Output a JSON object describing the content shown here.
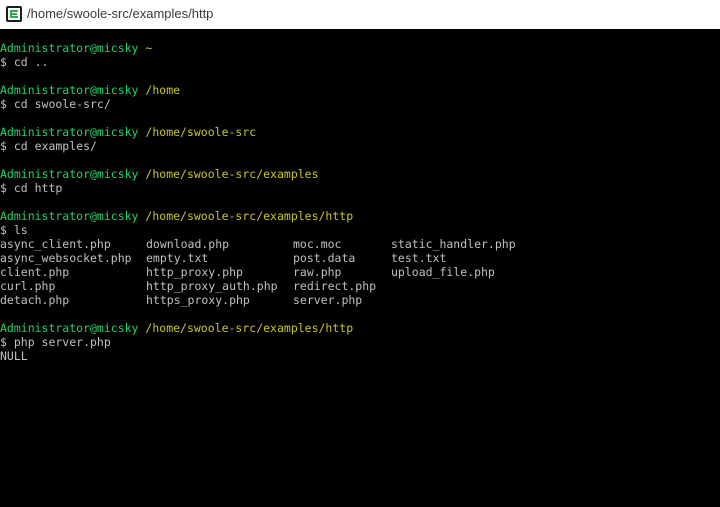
{
  "window": {
    "title": "/home/swoole-src/examples/http",
    "icon": "terminal-app-icon",
    "colors": {
      "background": "#000000",
      "text": "#c0c0c0",
      "user": "#23d16b",
      "path": "#c7c62c"
    }
  },
  "terminal": {
    "blocks": [
      {
        "user": "Administrator@micsky",
        "path": "~",
        "command": "$ cd .."
      },
      {
        "user": "Administrator@micsky",
        "path": "/home",
        "command": "$ cd swoole-src/"
      },
      {
        "user": "Administrator@micsky",
        "path": "/home/swoole-src",
        "command": "$ cd examples/"
      },
      {
        "user": "Administrator@micsky",
        "path": "/home/swoole-src/examples",
        "command": "$ cd http"
      },
      {
        "user": "Administrator@micsky",
        "path": "/home/swoole-src/examples/http",
        "command": "$ ls"
      }
    ],
    "ls_rows": [
      [
        "async_client.php",
        "download.php",
        "moc.moc",
        "static_handler.php"
      ],
      [
        "async_websocket.php",
        "empty.txt",
        "post.data",
        "test.txt"
      ],
      [
        "client.php",
        "http_proxy.php",
        "raw.php",
        "upload_file.php"
      ],
      [
        "curl.php",
        "http_proxy_auth.php",
        "redirect.php",
        ""
      ],
      [
        "detach.php",
        "https_proxy.php",
        "server.php",
        ""
      ]
    ],
    "last_block": {
      "user": "Administrator@micsky",
      "path": "/home/swoole-src/examples/http",
      "command": "$ php server.php"
    },
    "output": "NULL"
  }
}
